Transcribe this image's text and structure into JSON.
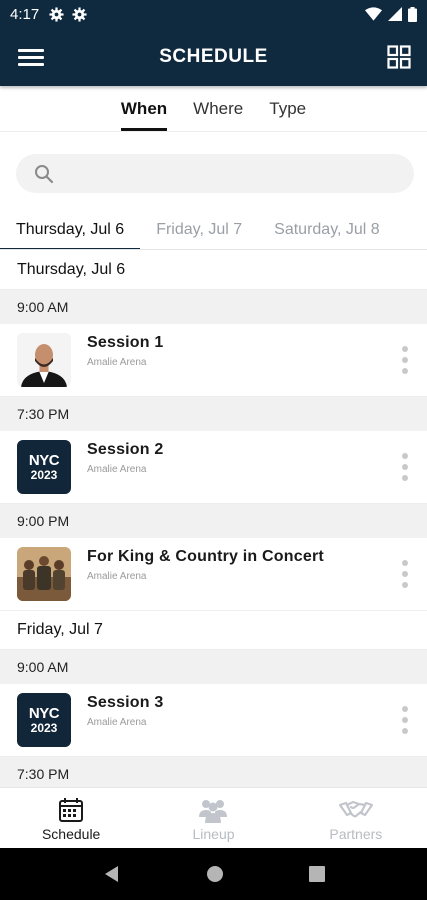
{
  "status_bar": {
    "time": "4:17"
  },
  "app_bar": {
    "title": "SCHEDULE"
  },
  "filter_tabs": [
    {
      "label": "When",
      "active": true
    },
    {
      "label": "Where",
      "active": false
    },
    {
      "label": "Type",
      "active": false
    }
  ],
  "search": {
    "placeholder": ""
  },
  "day_tabs": [
    {
      "label": "Thursday, Jul 6",
      "active": true
    },
    {
      "label": "Friday, Jul 7",
      "active": false
    },
    {
      "label": "Saturday, Jul 8",
      "active": false
    }
  ],
  "schedule": {
    "day1": {
      "date": "Thursday, Jul 6",
      "slot1": {
        "time": "9:00 AM",
        "session": {
          "title": "Session 1",
          "location": "Amalie Arena",
          "thumb": "speaker-photo"
        }
      },
      "slot2": {
        "time": "7:30 PM",
        "session": {
          "title": "Session 2",
          "location": "Amalie Arena",
          "thumb_line1": "NYC",
          "thumb_line2": "2023"
        }
      },
      "slot3": {
        "time": "9:00 PM",
        "session": {
          "title": "For King & Country in Concert",
          "location": "Amalie Arena",
          "thumb": "band-photo"
        }
      }
    },
    "day2": {
      "date": "Friday, Jul 7",
      "slot1": {
        "time": "9:00 AM",
        "session": {
          "title": "Session 3",
          "location": "Amalie Arena",
          "thumb_line1": "NYC",
          "thumb_line2": "2023"
        }
      },
      "slot2": {
        "time": "7:30 PM"
      }
    }
  },
  "bottom_nav": [
    {
      "label": "Schedule",
      "icon": "calendar-icon",
      "active": true
    },
    {
      "label": "Lineup",
      "icon": "people-icon",
      "active": false
    },
    {
      "label": "Partners",
      "icon": "handshake-icon",
      "active": false
    }
  ],
  "colors": {
    "primary": "#0f2a3f",
    "inactive": "#b8bcc2",
    "time_header_bg": "#f1f1f1"
  }
}
